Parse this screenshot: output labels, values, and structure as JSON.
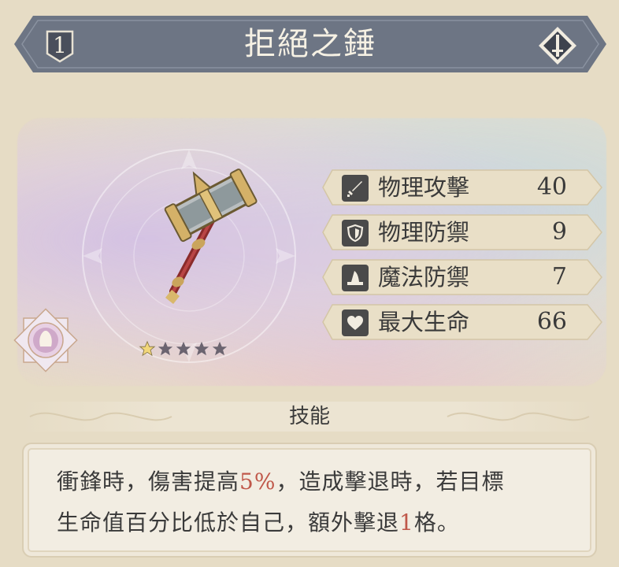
{
  "header": {
    "level": "1",
    "name": "拒絕之錘",
    "weapon_type_icon": "sword-icon"
  },
  "showcase": {
    "element_badge_icon": "element-crest-icon",
    "stars_total": 5,
    "stars_filled": 1
  },
  "stats": [
    {
      "icon": "sword-icon",
      "label": "物理攻擊",
      "value": "40"
    },
    {
      "icon": "shield-icon",
      "label": "物理防禦",
      "value": "9"
    },
    {
      "icon": "witch-hat-icon",
      "label": "魔法防禦",
      "value": "7"
    },
    {
      "icon": "heart-icon",
      "label": "最大生命",
      "value": "66"
    }
  ],
  "skill": {
    "title": "技能",
    "line1_a": "衝鋒時，傷害提高",
    "line1_hl": "5%",
    "line1_b": "，造成擊退時，若目標",
    "line2_a": "生命值百分比低於自己，額外擊退",
    "line2_hl": "1",
    "line2_b": "格。"
  },
  "colors": {
    "banner": "#6d7584",
    "stat_bg": "#e7dcc3",
    "highlight": "#c0584a",
    "background": "#e6dcc5"
  }
}
